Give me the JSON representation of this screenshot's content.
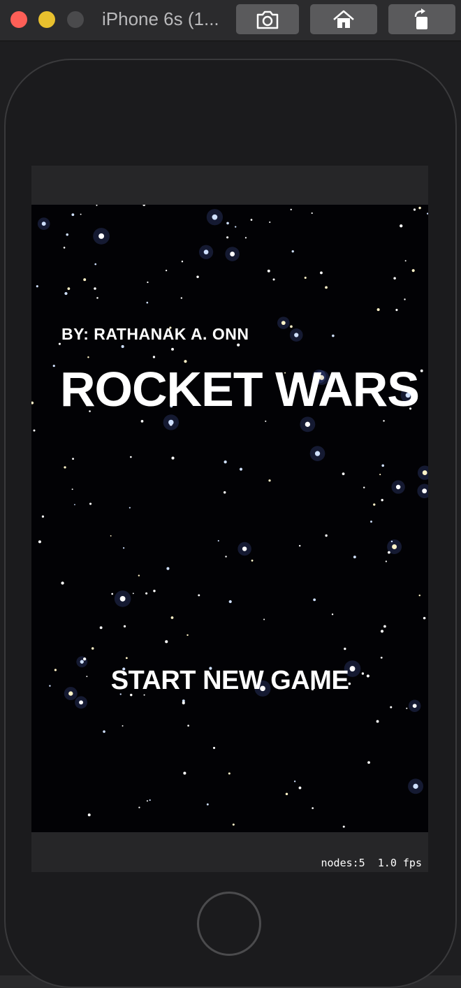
{
  "window": {
    "title": "iPhone 6s (1...",
    "buttons": [
      {
        "name": "screenshot",
        "icon": "camera-icon"
      },
      {
        "name": "home",
        "icon": "home-icon"
      },
      {
        "name": "rotate",
        "icon": "rotate-icon"
      }
    ]
  },
  "game": {
    "byline": "BY: RATHANAK A. ONN",
    "title": "ROCKET WARS",
    "start_label": "START NEW GAME",
    "background": "starfield"
  },
  "debug": {
    "stats": "nodes:5  1.0 fps"
  },
  "colors": {
    "close": "#fe5f57",
    "minimize": "#e8c02e",
    "zoom_disabled": "#4a4a4c",
    "space": "#020205"
  }
}
